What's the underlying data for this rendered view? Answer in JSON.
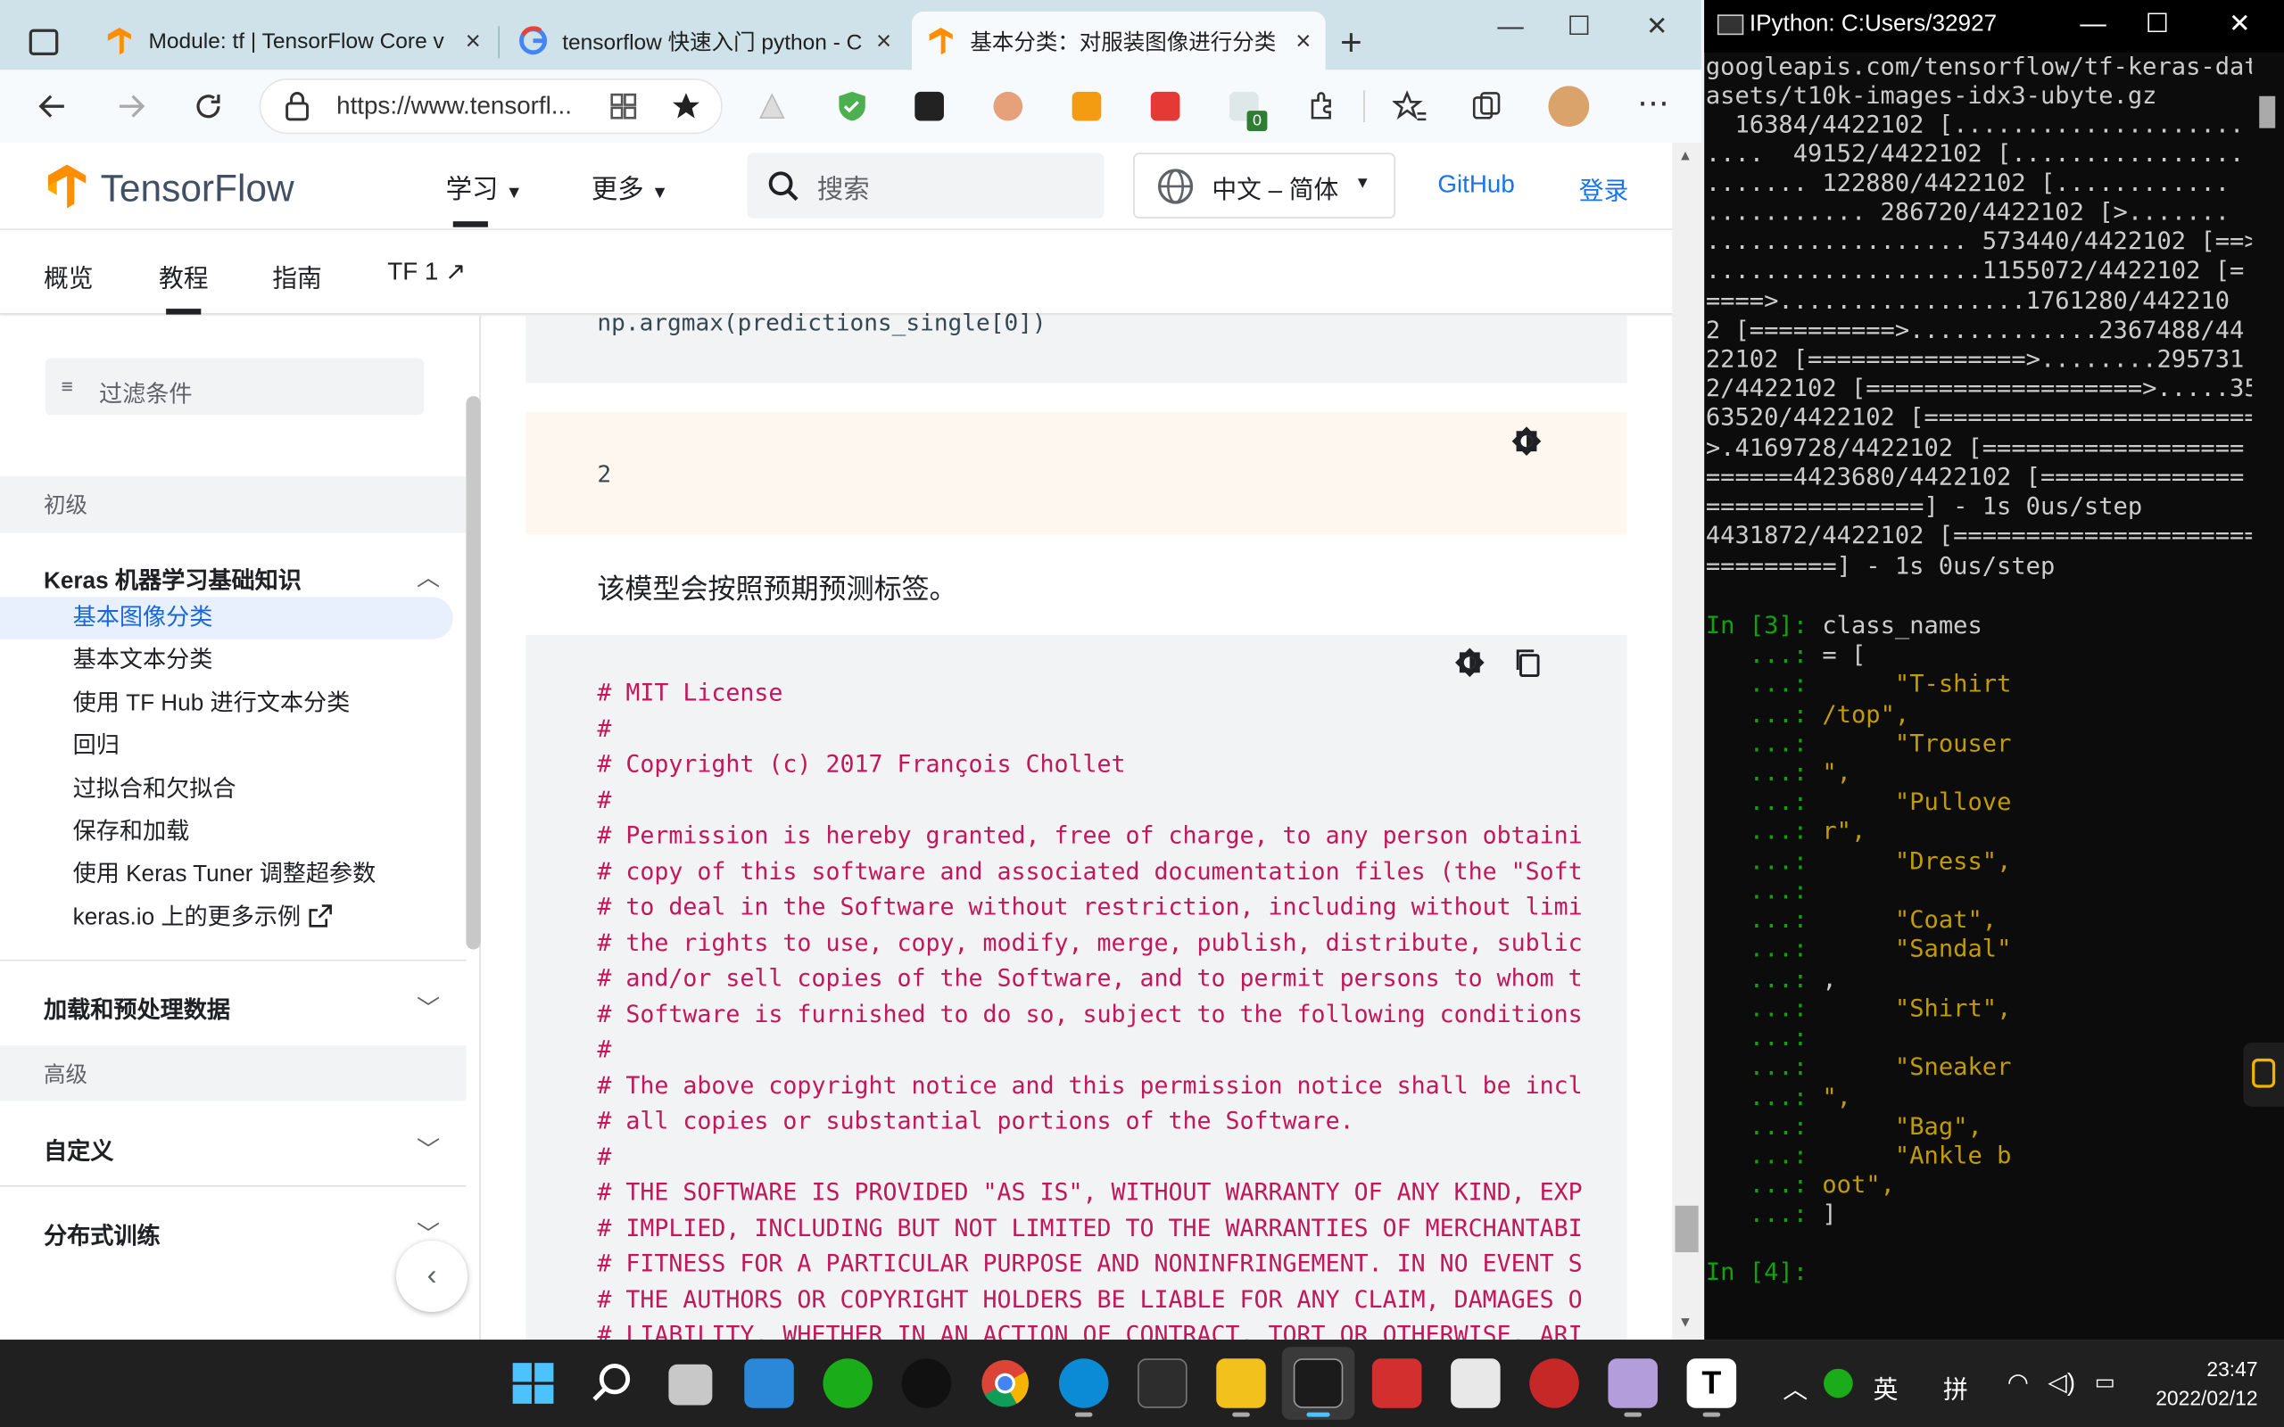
{
  "browser": {
    "tabs": [
      {
        "title": "Module: tf | TensorFlow Core v",
        "close": "×"
      },
      {
        "title": "tensorflow 快速入门 python - C",
        "close": "×"
      },
      {
        "title": "基本分类：对服装图像进行分类",
        "close": "×"
      }
    ],
    "new_tab": "+",
    "url": "https://www.tensorfl...",
    "window_controls": {
      "minimize": "—",
      "maximize": "☐",
      "close": "✕"
    },
    "ext_badge": "0"
  },
  "site": {
    "brand": "TensorFlow",
    "menu": [
      "学习",
      "更多"
    ],
    "search_placeholder": "搜索",
    "language": "中文 – 简体",
    "github": "GitHub",
    "login": "登录",
    "subnav": [
      "概览",
      "教程",
      "指南",
      "TF 1 ↗"
    ]
  },
  "sidebar": {
    "filter_placeholder": "过滤条件",
    "section_beginner": "初级",
    "group_keras": "Keras 机器学习基础知识",
    "items": [
      "基本图像分类",
      "基本文本分类",
      "使用 TF Hub 进行文本分类",
      "回归",
      "过拟合和欠拟合",
      "保存和加载",
      "使用 Keras Tuner 调整超参数",
      "keras.io 上的更多示例"
    ],
    "group_load": "加载和预处理数据",
    "section_advanced": "高级",
    "group_custom": "自定义",
    "group_distributed": "分布式训练",
    "collapse": "‹"
  },
  "content": {
    "code_line": "np.argmax(predictions_single[0])",
    "output": "2",
    "paragraph": "该模型会按照预期预测标签。",
    "license": [
      "# MIT License",
      "#",
      "# Copyright (c) 2017 François Chollet",
      "#",
      "# Permission is hereby granted, free of charge, to any person obtaini",
      "# copy of this software and associated documentation files (the \"Soft",
      "# to deal in the Software without restriction, including without limi",
      "# the rights to use, copy, modify, merge, publish, distribute, sublic",
      "# and/or sell copies of the Software, and to permit persons to whom t",
      "# Software is furnished to do so, subject to the following conditions",
      "#",
      "# The above copyright notice and this permission notice shall be incl",
      "# all copies or substantial portions of the Software.",
      "#",
      "# THE SOFTWARE IS PROVIDED \"AS IS\", WITHOUT WARRANTY OF ANY KIND, EXP",
      "# IMPLIED, INCLUDING BUT NOT LIMITED TO THE WARRANTIES OF MERCHANTABI",
      "# FITNESS FOR A PARTICULAR PURPOSE AND NONINFRINGEMENT. IN NO EVENT S",
      "# THE AUTHORS OR COPYRIGHT HOLDERS BE LIABLE FOR ANY CLAIM, DAMAGES O",
      "# LIABILITY, WHETHER IN AN ACTION OF CONTRACT, TORT OR OTHERWISE, ARI"
    ]
  },
  "terminal": {
    "title": "IPython: C:Users/32927",
    "lines": [
      "googleapis.com/tensorflow/tf-keras-dat",
      "asets/t10k-images-idx3-ubyte.gz",
      "  16384/4422102 [....................",
      "....  49152/4422102 [................",
      "....... 122880/4422102 [............",
      "........... 286720/4422102 [>.......",
      ".................. 573440/4422102 [==>..",
      "...................1155072/4422102 [=",
      "====>.................1761280/442210",
      "2 [==========>.............2367488/44",
      "22102 [===============>........295731",
      "2/4422102 [===================>.....35",
      "63520/4422102 [=======================",
      ">.4169728/4422102 [==================",
      "======4423680/4422102 [==============",
      "===============] - 1s 0us/step",
      "4431872/4422102 [=====================",
      "=========] - 1s 0us/step"
    ],
    "prompt3": "In [3]: ",
    "cmd3": "class_names",
    "cont": [
      {
        "p": "   ...: ",
        "t": "= ["
      },
      {
        "p": "   ...: ",
        "t": "     \"T-shirt"
      },
      {
        "p": "   ...: ",
        "t": "/top\","
      },
      {
        "p": "   ...: ",
        "t": "     \"Trouser"
      },
      {
        "p": "   ...: ",
        "t": "\","
      },
      {
        "p": "   ...: ",
        "t": "     \"Pullove"
      },
      {
        "p": "   ...: ",
        "t": "r\","
      },
      {
        "p": "   ...: ",
        "t": "     \"Dress\","
      },
      {
        "p": "   ...: ",
        "t": ""
      },
      {
        "p": "   ...: ",
        "t": "     \"Coat\","
      },
      {
        "p": "   ...: ",
        "t": "     \"Sandal\""
      },
      {
        "p": "   ...: ",
        "t": ","
      },
      {
        "p": "   ...: ",
        "t": "     \"Shirt\","
      },
      {
        "p": "   ...: ",
        "t": ""
      },
      {
        "p": "   ...: ",
        "t": "     \"Sneaker"
      },
      {
        "p": "   ...: ",
        "t": "\","
      },
      {
        "p": "   ...: ",
        "t": "     \"Bag\","
      },
      {
        "p": "   ...: ",
        "t": "     \"Ankle b"
      },
      {
        "p": "   ...: ",
        "t": "oot\","
      },
      {
        "p": "   ...: ",
        "t": "]"
      }
    ],
    "prompt4": "In [4]: "
  },
  "taskbar": {
    "ime1": "英",
    "ime2": "拼",
    "time": "23:47",
    "date": "2022/02/12"
  },
  "colors": {
    "tf_orange": "#ff8f00",
    "link_blue": "#1a73e8",
    "license_red": "#c2185b",
    "term_green": "#13a10e",
    "term_yellow": "#c19c00"
  }
}
